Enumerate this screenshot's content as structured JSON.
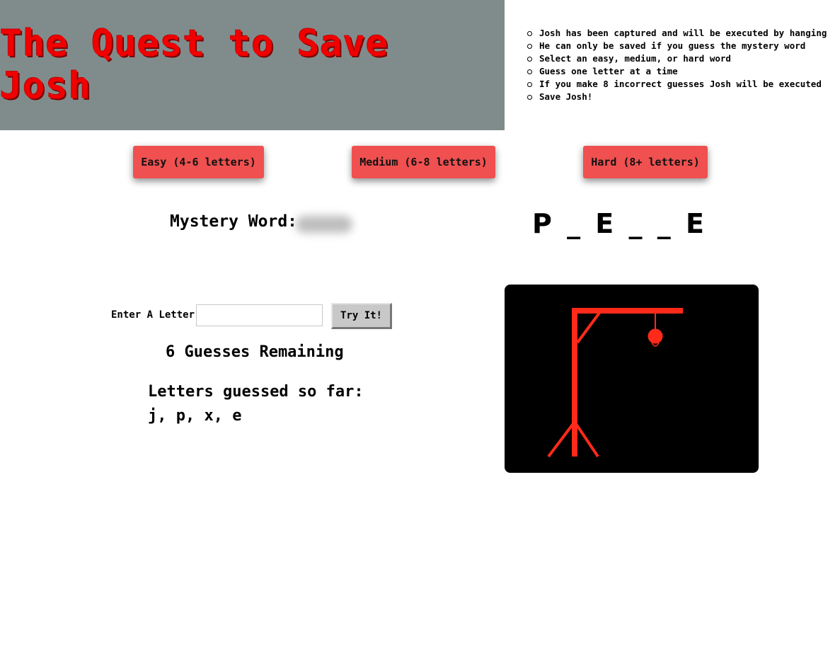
{
  "header": {
    "title": "The Quest to Save Josh"
  },
  "rules": [
    "Josh has been captured and will be executed by hanging",
    "He can only be saved if you guess the mystery word",
    "Select an easy, medium, or hard word",
    "Guess one letter at a time",
    "If you make 8 incorrect guesses Josh will be executed",
    "Save Josh!"
  ],
  "difficulty": {
    "easy_label": "Easy (4-6 letters)",
    "medium_label": "Medium (6-8 letters)",
    "hard_label": "Hard (8+ letters)"
  },
  "mystery": {
    "label": "Mystery Word:",
    "display": "P _ E _ _ E"
  },
  "guess_form": {
    "label": "Enter A Letter",
    "input_value": "",
    "button_label": "Try It!"
  },
  "status": {
    "remaining": "6 Guesses Remaining",
    "guessed_label": "Letters guessed so far:",
    "guessed_letters": "j, p, x, e"
  },
  "colors": {
    "banner": "#808c8c",
    "title": "#f00000",
    "button": "#f05050",
    "gallows": "#ff2a1a",
    "panel": "#000000"
  }
}
